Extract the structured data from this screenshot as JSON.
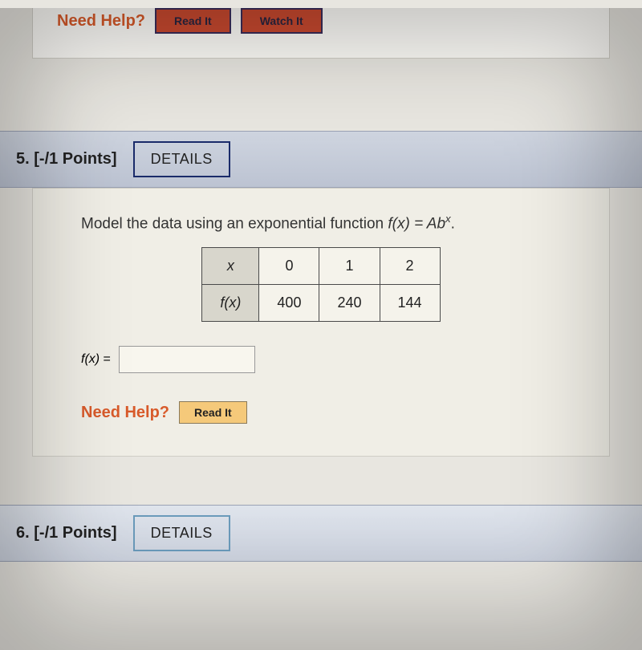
{
  "top_question": {
    "need_help_label": "Need Help?",
    "read_it_label": "Read It",
    "watch_it_label": "Watch It"
  },
  "q5": {
    "header_number": "5.",
    "points": "[-/1 Points]",
    "details_label": "DETAILS",
    "problem_text_prefix": "Model the data using an exponential function ",
    "problem_function": "f(x) = Ab",
    "problem_function_exp": "x",
    "problem_text_suffix": ".",
    "table": {
      "row_header_x": "x",
      "row_header_fx": "f(x)",
      "x_values": [
        "0",
        "1",
        "2"
      ],
      "fx_values": [
        "400",
        "240",
        "144"
      ]
    },
    "answer_label_fn": "f(x)",
    "answer_label_eq": " = ",
    "answer_value": "",
    "need_help_label": "Need Help?",
    "read_it_label": "Read It"
  },
  "q6": {
    "header_number": "6.",
    "points": "[-/1 Points]",
    "details_label": "DETAILS"
  }
}
